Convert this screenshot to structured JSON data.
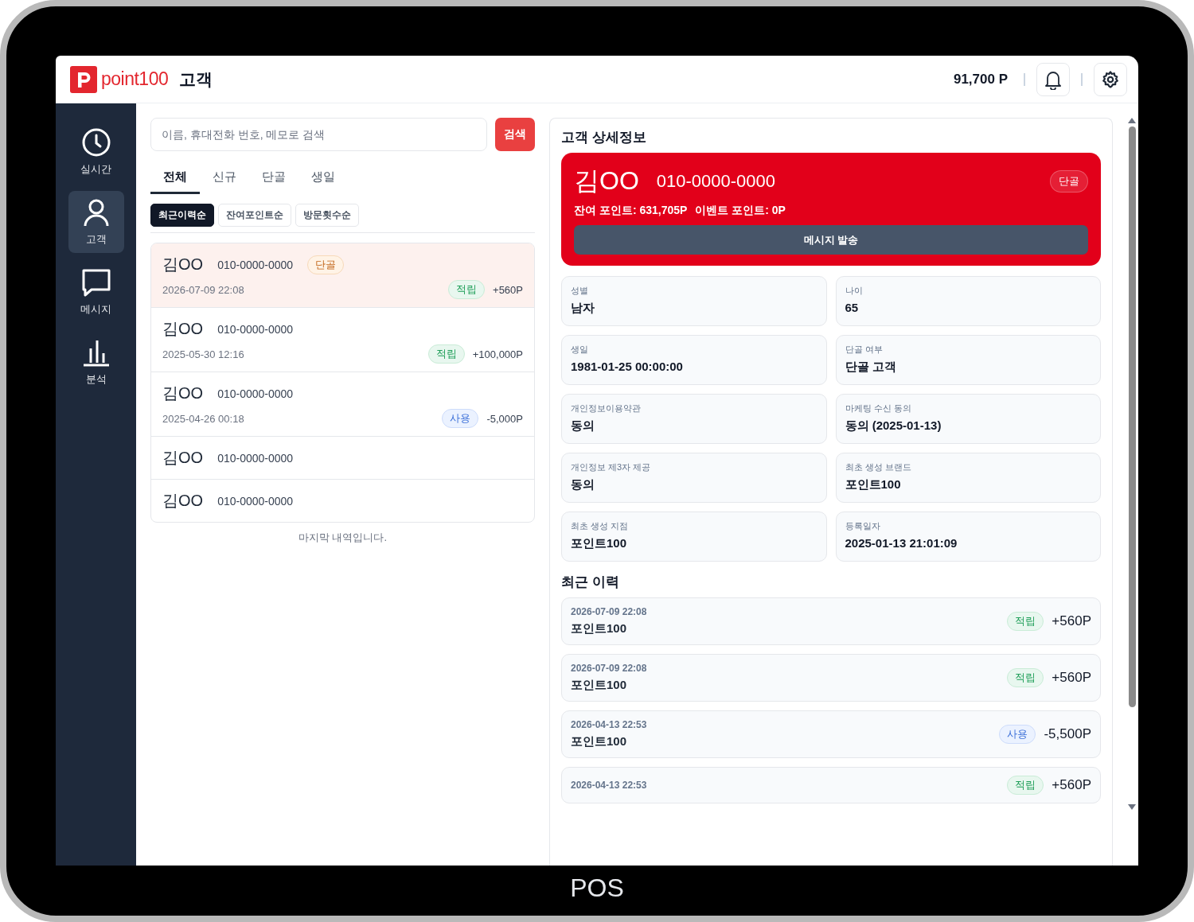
{
  "device": {
    "label": "POS"
  },
  "header": {
    "logo_text": "point100",
    "title": "고객",
    "points": "91,700 P"
  },
  "sidebar": {
    "items": [
      {
        "label": "실시간",
        "kind": "clock",
        "selected": false
      },
      {
        "label": "고객",
        "kind": "person",
        "selected": true
      },
      {
        "label": "메시지",
        "kind": "chat",
        "selected": false
      },
      {
        "label": "분석",
        "kind": "chart",
        "selected": false
      }
    ]
  },
  "search": {
    "placeholder": "이름, 휴대전화 번호, 메모로 검색",
    "button": "검색"
  },
  "tabs": [
    {
      "label": "전체",
      "selected": true
    },
    {
      "label": "신규",
      "selected": false
    },
    {
      "label": "단골",
      "selected": false
    },
    {
      "label": "생일",
      "selected": false
    }
  ],
  "sort_options": [
    {
      "label": "최근이력순",
      "selected": true
    },
    {
      "label": "잔여포인트순",
      "selected": false
    },
    {
      "label": "방문횟수순",
      "selected": false
    }
  ],
  "customers": [
    {
      "name": "김OO",
      "phone": "010-0000-0000",
      "tag": "단골",
      "date": "2026-07-09 22:08",
      "kind": "earn",
      "badge": "적립",
      "amount": "+560P",
      "selected": true
    },
    {
      "name": "김OO",
      "phone": "010-0000-0000",
      "date": "2025-05-30 12:16",
      "kind": "earn",
      "badge": "적립",
      "amount": "+100,000P",
      "selected": false
    },
    {
      "name": "김OO",
      "phone": "010-0000-0000",
      "date": "2025-04-26 00:18",
      "kind": "use",
      "badge": "사용",
      "amount": "-5,000P",
      "selected": false
    },
    {
      "name": "김OO",
      "phone": "010-0000-0000",
      "selected": false
    },
    {
      "name": "김OO",
      "phone": "010-0000-0000",
      "selected": false
    }
  ],
  "list_end": "마지막 내역입니다.",
  "detail": {
    "title": "고객 상세정보",
    "name": "김OO",
    "phone": "010-0000-0000",
    "tag": "단골",
    "balance": "잔여 포인트: 631,705P",
    "event_points": "이벤트 포인트: 0P",
    "message_button": "메시지 발송",
    "fields": [
      {
        "label": "성별",
        "value": "남자"
      },
      {
        "label": "나이",
        "value": "65"
      },
      {
        "label": "생일",
        "value": "1981-01-25 00:00:00"
      },
      {
        "label": "단골 여부",
        "value": "단골 고객"
      },
      {
        "label": "개인정보이용약관",
        "value": "동의"
      },
      {
        "label": "마케팅 수신 동의",
        "value": "동의 (2025-01-13)"
      },
      {
        "label": "개인정보 제3자 제공",
        "value": "동의"
      },
      {
        "label": "최초 생성 브랜드",
        "value": "포인트100"
      },
      {
        "label": "최초 생성 지점",
        "value": "포인트100"
      },
      {
        "label": "등록일자",
        "value": "2025-01-13 21:01:09"
      }
    ],
    "history_title": "최근 이력",
    "history": [
      {
        "date": "2026-07-09 22:08",
        "store": "포인트100",
        "kind": "earn",
        "badge": "적립",
        "amount": "+560P"
      },
      {
        "date": "2026-07-09 22:08",
        "store": "포인트100",
        "kind": "earn",
        "badge": "적립",
        "amount": "+560P"
      },
      {
        "date": "2026-04-13 22:53",
        "store": "포인트100",
        "kind": "use",
        "badge": "사용",
        "amount": "-5,500P"
      },
      {
        "date": "2026-04-13 22:53",
        "kind": "earn",
        "badge": "적립",
        "amount": "+560P"
      }
    ]
  }
}
